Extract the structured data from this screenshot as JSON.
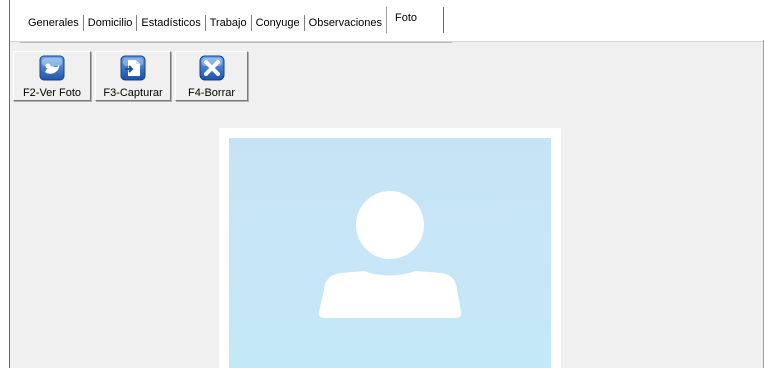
{
  "tabs": [
    {
      "label": "Generales"
    },
    {
      "label": "Domicilio"
    },
    {
      "label": "Estadísticos"
    },
    {
      "label": "Trabajo"
    },
    {
      "label": "Conyuge"
    },
    {
      "label": "Observaciones"
    },
    {
      "label": "Foto",
      "active": true
    }
  ],
  "toolbar": {
    "view_label": "F2-Ver Foto",
    "capture_label": "F3-Capturar",
    "delete_label": "F4-Borrar"
  },
  "icons": {
    "view": "photo-view-icon",
    "capture": "capture-icon",
    "delete": "delete-x-icon"
  },
  "colors": {
    "photo_bg": "#c6e3f6",
    "icon_blue": "#2f6fc9"
  }
}
